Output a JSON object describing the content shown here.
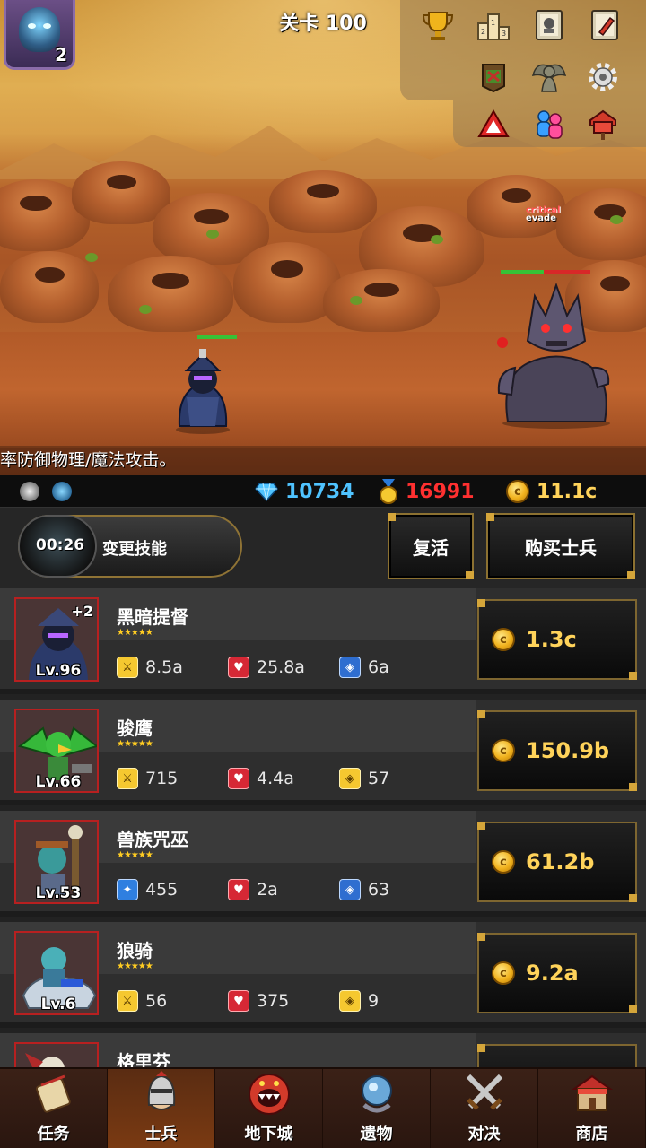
{
  "stage": {
    "title": "关卡 100"
  },
  "hero": {
    "level": "2"
  },
  "battle": {
    "floating_text": {
      "critical": "critical",
      "evade": "evade"
    },
    "ticker": "率防御物理/魔法攻击。"
  },
  "resources": {
    "gems": "10734",
    "medals": "16991",
    "gold": "11.1c"
  },
  "actions": {
    "skill_timer": "00:26",
    "skill_label": "变更技能",
    "revive_label": "复活",
    "buy_soldier_label": "购买士兵"
  },
  "soldiers": [
    {
      "name": "黑暗提督",
      "level": "Lv.96",
      "plus": "+2",
      "stars": "★★★★★",
      "attack": "8.5a",
      "attack_type": "physical",
      "hp": "25.8a",
      "defense": "6a",
      "defense_type": "magic",
      "cost": "1.3c"
    },
    {
      "name": "骏鹰",
      "level": "Lv.66",
      "plus": "",
      "stars": "★★★★★",
      "attack": "715",
      "attack_type": "physical",
      "hp": "4.4a",
      "defense": "57",
      "defense_type": "physical",
      "cost": "150.9b"
    },
    {
      "name": "兽族咒巫",
      "level": "Lv.53",
      "plus": "",
      "stars": "★★★★★",
      "attack": "455",
      "attack_type": "magic",
      "hp": "2a",
      "defense": "63",
      "defense_type": "magic",
      "cost": "61.2b"
    },
    {
      "name": "狼骑",
      "level": "Lv.6",
      "plus": "",
      "stars": "★★★★★",
      "attack": "56",
      "attack_type": "physical",
      "hp": "375",
      "defense": "9",
      "defense_type": "physical",
      "cost": "9.2a"
    },
    {
      "name": "格里芬",
      "level": "",
      "plus": "",
      "stars": "",
      "attack": "",
      "hp": "",
      "defense": "",
      "cost": ""
    }
  ],
  "nav": [
    {
      "label": "任务",
      "icon": "scroll-icon"
    },
    {
      "label": "士兵",
      "icon": "knight-helmet-icon"
    },
    {
      "label": "地下城",
      "icon": "monster-mouth-icon"
    },
    {
      "label": "遗物",
      "icon": "relic-orb-icon"
    },
    {
      "label": "对决",
      "icon": "crossed-swords-icon"
    },
    {
      "label": "商店",
      "icon": "shop-icon"
    }
  ],
  "colors": {
    "gems": "#4fc3ff",
    "medals": "#ff3030",
    "gold": "#ffd35a",
    "accent_border": "#8c7131"
  }
}
